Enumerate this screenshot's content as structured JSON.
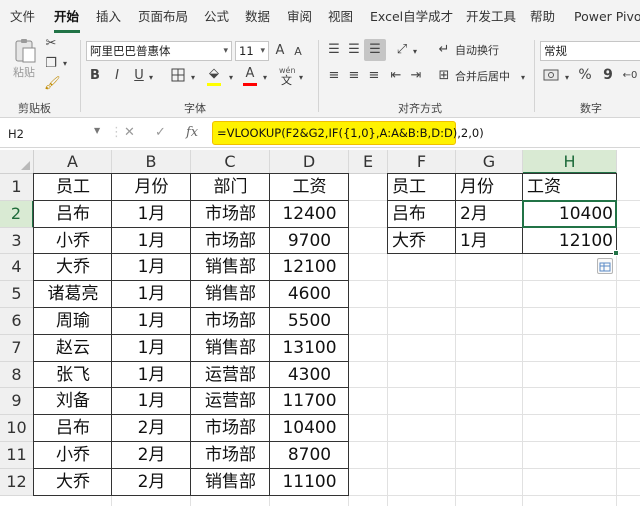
{
  "menu": {
    "items": [
      "文件",
      "开始",
      "插入",
      "页面布局",
      "公式",
      "数据",
      "审阅",
      "视图",
      "Excel自学成才",
      "开发工具",
      "帮助",
      "Power Pivot"
    ],
    "active": "开始"
  },
  "ribbon": {
    "clipboard": {
      "label": "剪贴板",
      "paste": "粘贴"
    },
    "font": {
      "label": "字体",
      "font_name": "阿里巴巴普惠体",
      "font_size": "11",
      "grow": "A",
      "shrink": "A",
      "bold": "B",
      "italic": "I",
      "underline": "U",
      "wen": "wén",
      "wen_sub": "文"
    },
    "alignment": {
      "label": "对齐方式",
      "wrap": "自动换行",
      "merge": "合并后居中"
    },
    "number": {
      "label": "数字",
      "format": "常规",
      "percent": "%",
      "comma": "9"
    },
    "colors": {
      "accent": "#217346",
      "fill": "#ffff00",
      "font": "#ff0000"
    }
  },
  "formula_bar": {
    "cell_ref": "H2",
    "cancel": "✕",
    "enter": "✓",
    "fx": "fx",
    "formula": "=VLOOKUP(F2&G2,IF({1,0},A:A&B:B,D:D),2,0)",
    "highlight": "#fff200"
  },
  "sheet": {
    "columns": [
      "A",
      "B",
      "C",
      "D",
      "E",
      "F",
      "G",
      "H"
    ],
    "rows": [
      "1",
      "2",
      "3",
      "4",
      "5",
      "6",
      "7",
      "8",
      "9",
      "10",
      "11",
      "12"
    ],
    "selected_column": "H",
    "selected_row": "2",
    "main_table": [
      [
        "员工",
        "月份",
        "部门",
        "工资"
      ],
      [
        "吕布",
        "1月",
        "市场部",
        "12400"
      ],
      [
        "小乔",
        "1月",
        "市场部",
        "9700"
      ],
      [
        "大乔",
        "1月",
        "销售部",
        "12100"
      ],
      [
        "诸葛亮",
        "1月",
        "销售部",
        "4600"
      ],
      [
        "周瑜",
        "1月",
        "市场部",
        "5500"
      ],
      [
        "赵云",
        "1月",
        "销售部",
        "13100"
      ],
      [
        "张飞",
        "1月",
        "运营部",
        "4300"
      ],
      [
        "刘备",
        "1月",
        "运营部",
        "11700"
      ],
      [
        "吕布",
        "2月",
        "市场部",
        "10400"
      ],
      [
        "小乔",
        "2月",
        "市场部",
        "8700"
      ],
      [
        "大乔",
        "2月",
        "销售部",
        "11100"
      ]
    ],
    "lookup_table": [
      [
        "员工",
        "月份",
        "工资"
      ],
      [
        "吕布",
        "2月",
        "10400"
      ],
      [
        "大乔",
        "1月",
        "12100"
      ]
    ]
  }
}
